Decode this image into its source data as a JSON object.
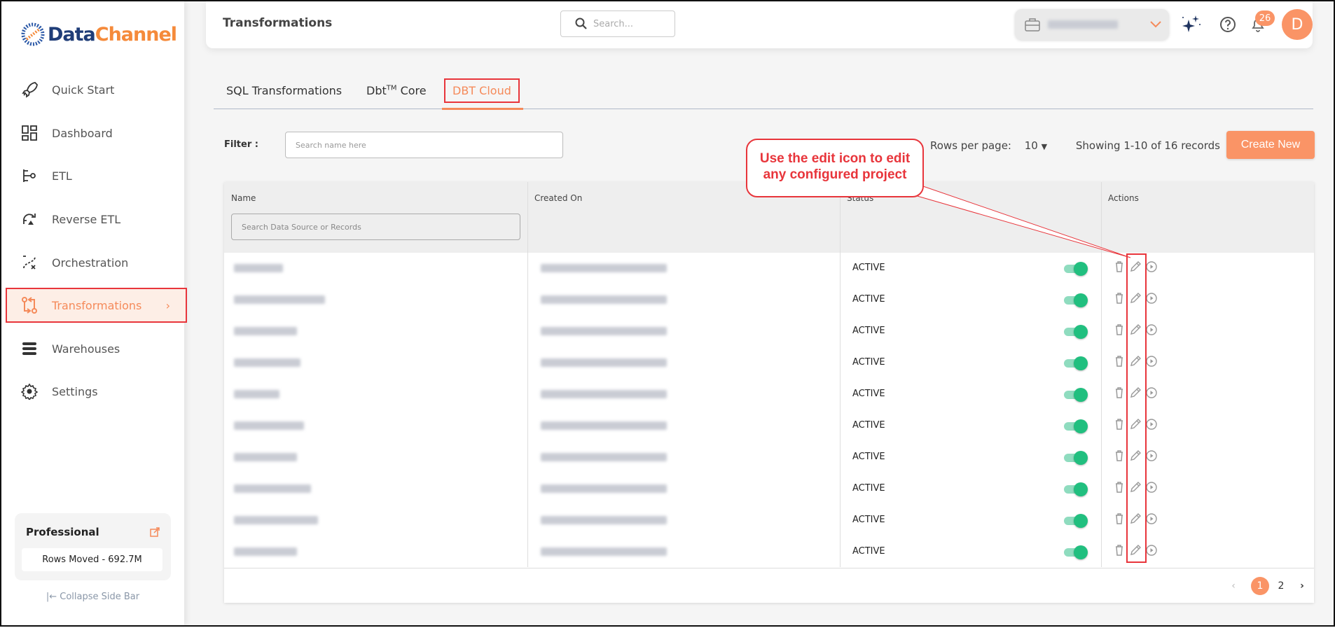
{
  "brand": {
    "name_part1": "Data",
    "name_part2": "Channel"
  },
  "sidebar": {
    "items": [
      {
        "label": "Quick Start",
        "icon": "rocket-icon"
      },
      {
        "label": "Dashboard",
        "icon": "dashboard-icon"
      },
      {
        "label": "ETL",
        "icon": "etl-icon"
      },
      {
        "label": "Reverse ETL",
        "icon": "reverse-etl-icon"
      },
      {
        "label": "Orchestration",
        "icon": "orchestration-icon"
      },
      {
        "label": "Transformations",
        "icon": "transformations-icon",
        "active": true
      },
      {
        "label": "Warehouses",
        "icon": "warehouse-icon"
      },
      {
        "label": "Settings",
        "icon": "gear-icon"
      }
    ],
    "plan": {
      "name": "Professional",
      "rows_moved": "Rows Moved - 692.7M"
    },
    "collapse_label": "|← Collapse Side Bar"
  },
  "header": {
    "title": "Transformations",
    "search_placeholder": "Search...",
    "notifications_count": "26",
    "avatar_initial": "D"
  },
  "tabs": [
    {
      "label": "SQL Transformations"
    },
    {
      "label": "Dbt",
      "sup": "TM",
      "suffix": " Core"
    },
    {
      "label": "DBT Cloud",
      "active": true
    }
  ],
  "toolbar": {
    "filter_label": "Filter :",
    "filter_placeholder": "Search name here",
    "rows_per_page_label": "Rows per page:",
    "rows_per_page": "10",
    "showing": "Showing 1-10 of 16 records",
    "create_label": "Create New"
  },
  "table": {
    "columns": [
      "Name",
      "Created On",
      "Status",
      "Actions"
    ],
    "name_search_placeholder": "Search Data Source or Records",
    "rows": [
      {
        "status": "ACTIVE"
      },
      {
        "status": "ACTIVE"
      },
      {
        "status": "ACTIVE"
      },
      {
        "status": "ACTIVE"
      },
      {
        "status": "ACTIVE"
      },
      {
        "status": "ACTIVE"
      },
      {
        "status": "ACTIVE"
      },
      {
        "status": "ACTIVE"
      },
      {
        "status": "ACTIVE"
      },
      {
        "status": "ACTIVE"
      }
    ]
  },
  "pagination": {
    "pages": [
      "1",
      "2"
    ],
    "current": "1"
  },
  "annotation": {
    "line1": "Use the edit icon to edit",
    "line2": "any configured project"
  },
  "colors": {
    "accent": "#fa9466",
    "brand_blue": "#1f3d78",
    "toggle_on": "#21bf7f",
    "annotation_red": "#e8353b"
  }
}
